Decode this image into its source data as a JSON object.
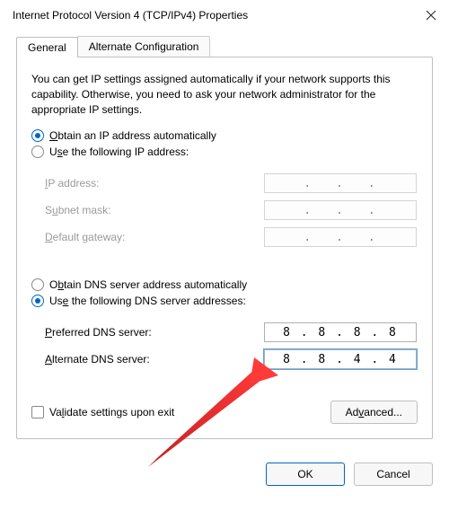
{
  "window": {
    "title": "Internet Protocol Version 4 (TCP/IPv4) Properties"
  },
  "tabs": {
    "general": "General",
    "alternate": "Alternate Configuration"
  },
  "intro": "You can get IP settings assigned automatically if your network supports this capability. Otherwise, you need to ask your network administrator for the appropriate IP settings.",
  "ip": {
    "auto_label": "Obtain an IP address automatically",
    "manual_label": "Use the following IP address:",
    "auto_selected": true,
    "fields": {
      "ip_address_label": "IP address:",
      "subnet_label": "Subnet mask:",
      "gateway_label": "Default gateway:",
      "ip_address_value": "",
      "subnet_value": "",
      "gateway_value": ""
    }
  },
  "dns": {
    "auto_label": "Obtain DNS server address automatically",
    "manual_label": "Use the following DNS server addresses:",
    "manual_selected": true,
    "preferred_label": "Preferred DNS server:",
    "alternate_label": "Alternate DNS server:",
    "preferred_value": "8 . 8 . 8 . 8",
    "alternate_value": "8 . 8 . 4 . 4"
  },
  "validate_label": "Validate settings upon exit",
  "advanced_label": "Advanced...",
  "buttons": {
    "ok": "OK",
    "cancel": "Cancel"
  },
  "accent_color": "#0067c0"
}
